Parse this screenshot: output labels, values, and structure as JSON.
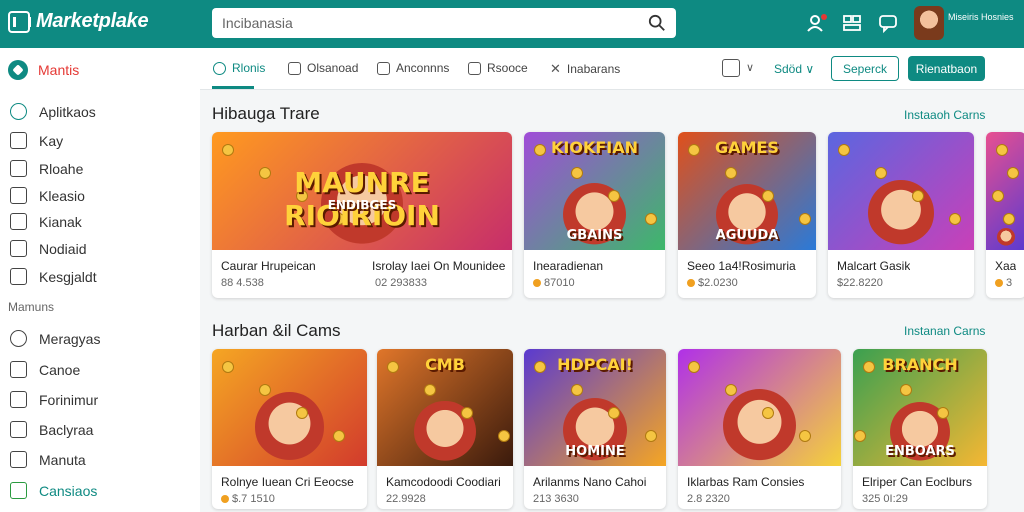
{
  "header": {
    "logo_text": "Marketplake",
    "search_value": "Incibanasia",
    "icons": [
      "search-icon",
      "user-add-icon",
      "grid-icon",
      "chat-icon"
    ],
    "user_name": "Miseiris Hosnies"
  },
  "sidebar": {
    "top_label": "Mantis",
    "items": [
      {
        "label": "Aplitkaos",
        "icon": "apps-icon"
      },
      {
        "label": "Kay",
        "icon": "key-icon"
      },
      {
        "label": "Rloahe",
        "icon": "doc-icon"
      },
      {
        "label": "Kleasio",
        "icon": "home-icon"
      },
      {
        "label": "Kianak",
        "icon": "box-icon"
      },
      {
        "label": "Nodiaid",
        "icon": "list-icon"
      },
      {
        "label": "Kesgjaldt",
        "icon": "folder-icon"
      }
    ],
    "section_label": "Mamuns",
    "items2": [
      {
        "label": "Meragyas",
        "icon": "chat-icon"
      },
      {
        "label": "Canoe",
        "icon": "tag-icon"
      },
      {
        "label": "Forinimur",
        "icon": "doc-icon"
      },
      {
        "label": "Baclyraa",
        "icon": "home-icon"
      },
      {
        "label": "Manuta",
        "icon": "box-icon"
      },
      {
        "label": "Cansiaos",
        "icon": "check-icon"
      }
    ]
  },
  "tabs": [
    {
      "label": "Rlonis",
      "active": true
    },
    {
      "label": "Olsanoad",
      "active": false
    },
    {
      "label": "Anconnns",
      "active": false
    },
    {
      "label": "Rsooce",
      "active": false
    },
    {
      "label": "Inabarans",
      "active": false
    }
  ],
  "toolbar": {
    "sort_label": "Sdöd",
    "button_outline": "Seperck",
    "button_solid": "Rienatbaon"
  },
  "section1": {
    "title": "Hibauga Trare",
    "link": "Instaaoh Carns",
    "cards": [
      {
        "name": "Caurar Hrupeican",
        "price": "88 4.538",
        "thumb_text": "MAUNRE RIOIRIOIN",
        "thumb_sub": "ENDIBGES",
        "colors": [
          "#ff9a1f",
          "#c72e6a"
        ],
        "coin": false
      },
      {
        "name": "Isrolay Iaei On Mounidee",
        "price": "02 293833",
        "thumb_text": "",
        "thumb_sub": "",
        "colors": [
          "#f7b733",
          "#8a2b9c"
        ],
        "coin": false
      },
      {
        "name": "Inearadienan",
        "price": "87010",
        "thumb_text": "KIOKFIAN",
        "thumb_sub": "GBAINS",
        "colors": [
          "#a04cd8",
          "#3db86a"
        ],
        "coin": true
      },
      {
        "name": "Seeo 1a4!Rosimuria",
        "price": "$2.0230",
        "thumb_text": "GAMES",
        "thumb_sub": "AGUUDA",
        "colors": [
          "#e0501a",
          "#2a7ad8"
        ],
        "coin": true
      },
      {
        "name": "Malcart Gasik",
        "price": "$22.8220",
        "thumb_text": "",
        "thumb_sub": "",
        "colors": [
          "#5b66e0",
          "#c940b8"
        ],
        "coin": false
      },
      {
        "name": "Xaa",
        "price": "3",
        "thumb_text": "",
        "thumb_sub": "",
        "colors": [
          "#e85090",
          "#5a3ad0"
        ],
        "coin": true
      }
    ]
  },
  "section2": {
    "title": "Harban &il Cams",
    "link": "Instanan Carns",
    "cards": [
      {
        "name": "Rolnye Iuean Cri Eeocse",
        "price": "$.7 1510",
        "thumb_text": "",
        "thumb_sub": "",
        "colors": [
          "#f5a623",
          "#d23b2c"
        ],
        "coin": true
      },
      {
        "name": "Kamcodoodi Coodiari",
        "price": "22.9928",
        "thumb_text": "CMB",
        "thumb_sub": "",
        "colors": [
          "#e0762a",
          "#3a1a0c"
        ],
        "coin": false
      },
      {
        "name": "Arilanms Nano Cahoi",
        "price": "213 3630",
        "thumb_text": "HDPCAI!",
        "thumb_sub": "HOMINE",
        "colors": [
          "#5a3ad0",
          "#f5a623"
        ],
        "coin": false
      },
      {
        "name": "Iklarbas Ram Consies",
        "price": "2.8 2320",
        "thumb_text": "",
        "thumb_sub": "",
        "colors": [
          "#b030e8",
          "#f5d23a"
        ],
        "coin": false
      },
      {
        "name": "Elriper Can Eoclburs",
        "price": "325 0I:29",
        "thumb_text": "BRANCH",
        "thumb_sub": "ENBOARS",
        "colors": [
          "#3aa050",
          "#f5b733"
        ],
        "coin": false
      }
    ]
  }
}
